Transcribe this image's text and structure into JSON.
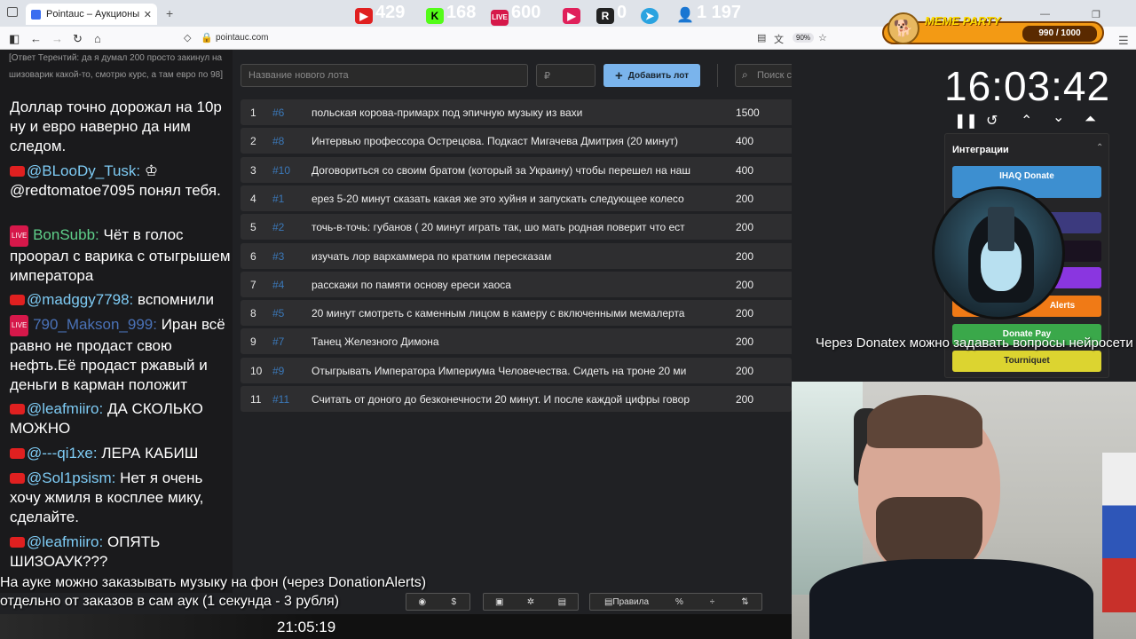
{
  "browser": {
    "tab_title": "Pointauc – Аукционы, лотереи",
    "url": "pointauc.com",
    "zoom": "90%"
  },
  "meme": {
    "title": "MEME PARTY",
    "count": "990 / 1000"
  },
  "chat": {
    "top_text": "[Ответ Терентий: да я думал 200 просто закинул на шизоварик какой-то, смотрю курс, а там евро по 98]",
    "messages": [
      {
        "nick": "",
        "text": "Доллар точно дорожал на 10р ну и евро наверно да ним следом."
      },
      {
        "nick": "@BLooDy_Tusk:",
        "text": ""
      },
      {
        "nick": "",
        "text": "@redtomatoe7095 понял тебя."
      },
      {
        "nick": "BonSubb:",
        "text": "Чёт в голос проорал с варика с отыгрышем императора"
      },
      {
        "nick": "@madggy7798:",
        "text": "вспомнили"
      },
      {
        "nick": "790_Makson_999:",
        "text": "Иран всё равно не продаст свою нефть.Её продаст ржавый и деньги в карман положит"
      },
      {
        "nick": "@leafmiiro:",
        "text": "ДА СКОЛЬКО МОЖНО"
      },
      {
        "nick": "@---qi1xe:",
        "text": "ЛЕРА КАБИШ"
      },
      {
        "nick": "@Sol1psism:",
        "text": "Нет я очень хочу жмиля в косплее мику, сделайте."
      },
      {
        "nick": "@leafmiiro:",
        "text": "ОПЯТЬ ШИЗОАУК???"
      }
    ]
  },
  "form": {
    "name_placeholder": "Название нового лота",
    "amount_placeholder": "₽",
    "add_label": "Добавить лот",
    "search_placeholder": "Поиск среди лотов..."
  },
  "lots": [
    {
      "n": "1",
      "id": "#6",
      "name": "польская корова-примарх под эпичную музыку из вахи",
      "amount": "1500"
    },
    {
      "n": "2",
      "id": "#8",
      "name": "Интервью профессора Острецова. Подкаст Мигачева Дмитрия (20 минут)",
      "amount": "400"
    },
    {
      "n": "3",
      "id": "#10",
      "name": "Договориться со своим братом (который за Украину) чтобы перешел на наш",
      "amount": "400"
    },
    {
      "n": "4",
      "id": "#1",
      "name": "ерез 5-20 минут сказать какая же это хуйня и запускать следующее колесо",
      "amount": "200"
    },
    {
      "n": "5",
      "id": "#2",
      "name": "точь-в-точь: губанов ( 20 минут играть так, шо мать родная поверит что ест",
      "amount": "200"
    },
    {
      "n": "6",
      "id": "#3",
      "name": "изучать лор вархаммера по кратким пересказам",
      "amount": "200"
    },
    {
      "n": "7",
      "id": "#4",
      "name": "расскажи по памяти основу ереси хаоса",
      "amount": "200"
    },
    {
      "n": "8",
      "id": "#5",
      "name": "20 минут смотреть с каменным лицом в камеру с включенными мемалерта",
      "amount": "200"
    },
    {
      "n": "9",
      "id": "#7",
      "name": "Танец Железного Димона",
      "amount": "200"
    },
    {
      "n": "10",
      "id": "#9",
      "name": "Отыгрывать Императора Империума Человечества. Сидеть на троне 20 ми",
      "amount": "200"
    },
    {
      "n": "11",
      "id": "#11",
      "name": "Считать от доного до безконечности 20 минут. И после каждой цифры говор",
      "amount": "200"
    }
  ],
  "timer": {
    "value": "16:03:42"
  },
  "integrations": {
    "title": "Интеграции",
    "ihaq_label": "IHAQ Donate",
    "alerts_label": "Alerts",
    "donatepay_label": "Donate Pay",
    "tourniquet_label": "Tourniquet"
  },
  "overlay": {
    "donatex": "Через Donatex можно задавать вопросы нейросети",
    "bottom1": "На ауке можно заказывать музыку на фон (через DonationAlerts)",
    "bottom2": "отдельно от заказов в сам аук (1 секунда - 3 рубля)"
  },
  "toolbar": {
    "rules": "Правила"
  },
  "stats": {
    "clock": "21:05:19",
    "youtube": "429",
    "kick": "168",
    "vkl": "600",
    "rutube": "0",
    "viewers": "1 197"
  }
}
